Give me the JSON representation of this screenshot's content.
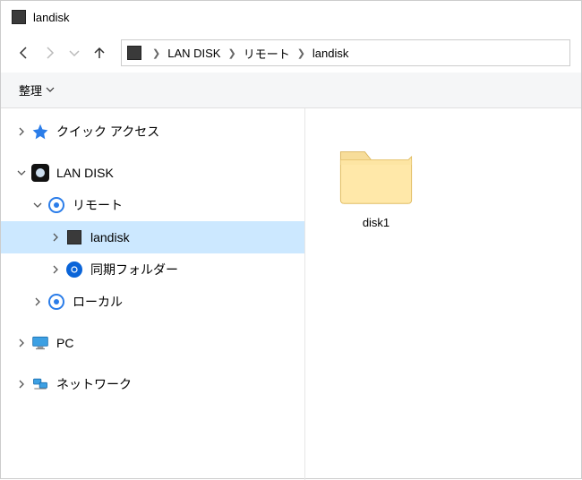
{
  "titlebar": {
    "text": "landisk"
  },
  "breadcrumb": {
    "items": [
      "LAN DISK",
      "リモート",
      "landisk"
    ]
  },
  "toolbar": {
    "organize": "整理"
  },
  "sidebar": {
    "quick_access": "クイック アクセス",
    "lan_disk": "LAN DISK",
    "remote": "リモート",
    "landisk": "landisk",
    "sync_folder": "同期フォルダー",
    "local": "ローカル",
    "pc": "PC",
    "network": "ネットワーク"
  },
  "files": [
    {
      "name": "disk1",
      "type": "folder"
    }
  ]
}
